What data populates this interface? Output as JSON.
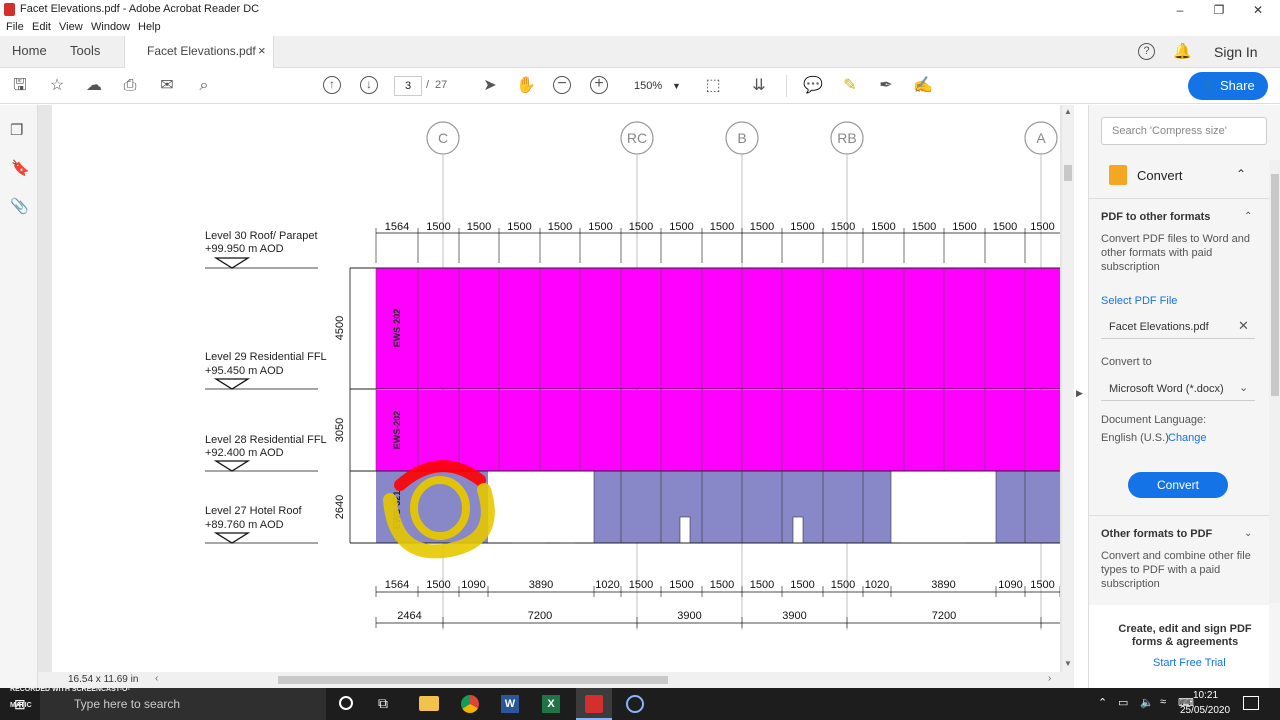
{
  "window": {
    "title": "Facet Elevations.pdf - Adobe Acrobat Reader DC",
    "minimize": "–",
    "maximize": "❐",
    "close": "✕"
  },
  "menu": [
    "File",
    "Edit",
    "View",
    "Window",
    "Help"
  ],
  "tabs": {
    "home": "Home",
    "tools": "Tools",
    "document": "Facet Elevations.pdf",
    "close": "×"
  },
  "header": {
    "sign_in": "Sign In",
    "share": "Share"
  },
  "toolbar": {
    "page_current": "3",
    "page_sep": "/",
    "page_total": "27",
    "zoom": "150%"
  },
  "drawing": {
    "grid_labels": [
      "C",
      "RC",
      "B",
      "RB",
      "A"
    ],
    "levels": [
      {
        "name": "Level 30 Roof/ Parapet",
        "aod": "+99.950 m AOD"
      },
      {
        "name": "Level 29 Residential FFL",
        "aod": "+95.450 m AOD"
      },
      {
        "name": "Level 28 Residential FFL",
        "aod": "+92.400 m AOD"
      },
      {
        "name": "Level 27 Hotel Roof",
        "aod": "+89.760 m AOD"
      }
    ],
    "top_dims": [
      "1564",
      "1500",
      "1500",
      "1500",
      "1500",
      "1500",
      "1500",
      "1500",
      "1500",
      "1500",
      "1500",
      "1500",
      "1500",
      "1500",
      "1500",
      "1500",
      "1500"
    ],
    "vertical_dims": [
      "4500",
      "3050",
      "2640"
    ],
    "panel_tags": [
      "EWS-202",
      "EWS-202",
      "EWS-321"
    ],
    "bottom_dims": [
      "1564",
      "1500",
      "1090",
      "3890",
      "1020",
      "1500",
      "1500",
      "1500",
      "1500",
      "1500",
      "1500",
      "1020",
      "3890",
      "1090",
      "1500"
    ],
    "span_dims": [
      "2464",
      "7200",
      "3900",
      "3900",
      "7200"
    ],
    "page_size": "16.54 x 11.69 in",
    "colors": {
      "upper": "#ff00ff",
      "lower": "#8888c8",
      "markup_red": "#ff0000",
      "markup_yellow": "#e6c800"
    }
  },
  "right_pane": {
    "search_placeholder": "Search 'Compress size'",
    "convert_title": "Convert",
    "pdf_to_other": "PDF to other formats",
    "pdf_to_other_desc": "Convert PDF files to Word and other formats with paid subscription",
    "select_file": "Select PDF File",
    "file_name": "Facet Elevations.pdf",
    "convert_to": "Convert to",
    "format": "Microsoft Word (*.docx)",
    "doc_lang_label": "Document Language:",
    "doc_lang": "English (U.S.)",
    "change": "Change",
    "convert_button": "Convert",
    "other_formats": "Other formats to PDF",
    "other_formats_desc": "Convert and combine other file types to PDF with a paid subscription",
    "promo": "Create, edit and sign PDF forms & agreements",
    "trial": "Start Free Trial"
  },
  "taskbar": {
    "search": "Type here to search",
    "watermark": "RECORDED WITH SCREENCAST-O-MATIC",
    "time": "10:21",
    "date": "25/05/2020"
  }
}
